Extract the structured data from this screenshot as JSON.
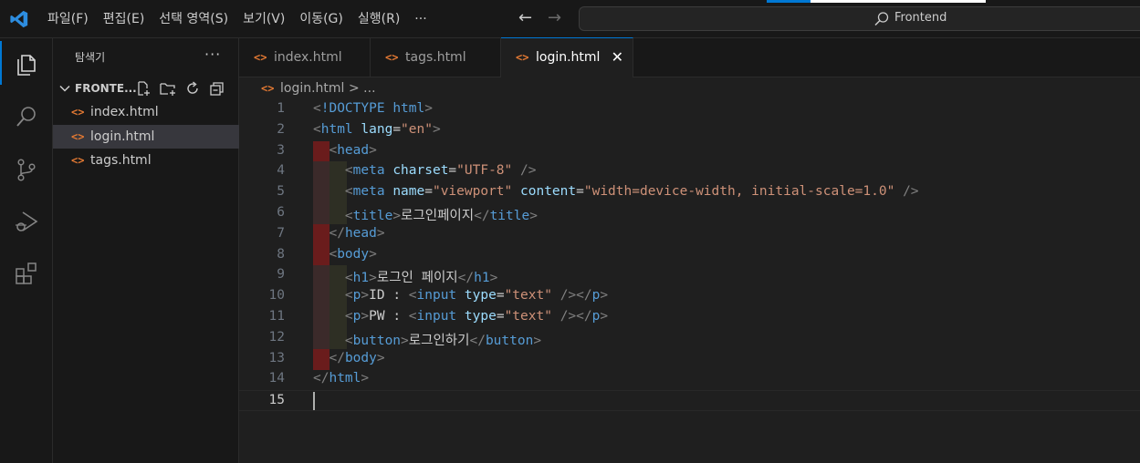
{
  "menu": [
    "파일(F)",
    "편집(E)",
    "선택 영역(S)",
    "보기(V)",
    "이동(G)",
    "실행(R)",
    "···"
  ],
  "nav": {
    "back": "←",
    "forward": "→"
  },
  "command_center": {
    "label": "Frontend"
  },
  "sidebar": {
    "title": "탐색기",
    "more": "···",
    "folder": "FRONTE...",
    "files": [
      {
        "name": "index.html",
        "selected": false
      },
      {
        "name": "login.html",
        "selected": true
      },
      {
        "name": "tags.html",
        "selected": false
      }
    ]
  },
  "tabs": [
    {
      "label": "index.html",
      "active": false
    },
    {
      "label": "tags.html",
      "active": false
    },
    {
      "label": "login.html",
      "active": true
    }
  ],
  "tab_close": "✕",
  "file_icon": "<>",
  "breadcrumb": {
    "file": "login.html",
    "rest": "> ..."
  },
  "editor": {
    "current_line": 15,
    "lines": [
      [
        [
          "br",
          "<"
        ],
        [
          "tag",
          "!DOCTYPE "
        ],
        [
          "tag",
          "html"
        ],
        [
          "br",
          ">"
        ]
      ],
      [
        [
          "br",
          "<"
        ],
        [
          "tag",
          "html"
        ],
        [
          "txt",
          " "
        ],
        [
          "attr",
          "lang"
        ],
        [
          "txt",
          "="
        ],
        [
          "str",
          "\"en\""
        ],
        [
          "br",
          ">"
        ]
      ],
      [
        [
          "txt",
          "  "
        ],
        [
          "br",
          "<"
        ],
        [
          "tag",
          "head"
        ],
        [
          "br",
          ">"
        ]
      ],
      [
        [
          "txt",
          "    "
        ],
        [
          "br",
          "<"
        ],
        [
          "tag",
          "meta"
        ],
        [
          "txt",
          " "
        ],
        [
          "attr",
          "charset"
        ],
        [
          "txt",
          "="
        ],
        [
          "str",
          "\"UTF-8\""
        ],
        [
          "txt",
          " "
        ],
        [
          "br",
          "/>"
        ]
      ],
      [
        [
          "txt",
          "    "
        ],
        [
          "br",
          "<"
        ],
        [
          "tag",
          "meta"
        ],
        [
          "txt",
          " "
        ],
        [
          "attr",
          "name"
        ],
        [
          "txt",
          "="
        ],
        [
          "str",
          "\"viewport\""
        ],
        [
          "txt",
          " "
        ],
        [
          "attr",
          "content"
        ],
        [
          "txt",
          "="
        ],
        [
          "str",
          "\"width=device-width, initial-scale=1.0\""
        ],
        [
          "txt",
          " "
        ],
        [
          "br",
          "/>"
        ]
      ],
      [
        [
          "txt",
          "    "
        ],
        [
          "br",
          "<"
        ],
        [
          "tag",
          "title"
        ],
        [
          "br",
          ">"
        ],
        [
          "txt",
          "로그인페이지"
        ],
        [
          "br",
          "</"
        ],
        [
          "tag",
          "title"
        ],
        [
          "br",
          ">"
        ]
      ],
      [
        [
          "txt",
          "  "
        ],
        [
          "br",
          "</"
        ],
        [
          "tag",
          "head"
        ],
        [
          "br",
          ">"
        ]
      ],
      [
        [
          "txt",
          "  "
        ],
        [
          "br",
          "<"
        ],
        [
          "tag",
          "body"
        ],
        [
          "br",
          ">"
        ]
      ],
      [
        [
          "txt",
          "    "
        ],
        [
          "br",
          "<"
        ],
        [
          "tag",
          "h1"
        ],
        [
          "br",
          ">"
        ],
        [
          "txt",
          "로그인 페이지"
        ],
        [
          "br",
          "</"
        ],
        [
          "tag",
          "h1"
        ],
        [
          "br",
          ">"
        ]
      ],
      [
        [
          "txt",
          "    "
        ],
        [
          "br",
          "<"
        ],
        [
          "tag",
          "p"
        ],
        [
          "br",
          ">"
        ],
        [
          "txt",
          "ID : "
        ],
        [
          "br",
          "<"
        ],
        [
          "tag",
          "input"
        ],
        [
          "txt",
          " "
        ],
        [
          "attr",
          "type"
        ],
        [
          "txt",
          "="
        ],
        [
          "str",
          "\"text\""
        ],
        [
          "txt",
          " "
        ],
        [
          "br",
          "/></"
        ],
        [
          "tag",
          "p"
        ],
        [
          "br",
          ">"
        ]
      ],
      [
        [
          "txt",
          "    "
        ],
        [
          "br",
          "<"
        ],
        [
          "tag",
          "p"
        ],
        [
          "br",
          ">"
        ],
        [
          "txt",
          "PW : "
        ],
        [
          "br",
          "<"
        ],
        [
          "tag",
          "input"
        ],
        [
          "txt",
          " "
        ],
        [
          "attr",
          "type"
        ],
        [
          "txt",
          "="
        ],
        [
          "str",
          "\"text\""
        ],
        [
          "txt",
          " "
        ],
        [
          "br",
          "/></"
        ],
        [
          "tag",
          "p"
        ],
        [
          "br",
          ">"
        ]
      ],
      [
        [
          "txt",
          "    "
        ],
        [
          "br",
          "<"
        ],
        [
          "tag",
          "button"
        ],
        [
          "br",
          ">"
        ],
        [
          "txt",
          "로그인하기"
        ],
        [
          "br",
          "</"
        ],
        [
          "tag",
          "button"
        ],
        [
          "br",
          ">"
        ]
      ],
      [
        [
          "txt",
          "  "
        ],
        [
          "br",
          "</"
        ],
        [
          "tag",
          "body"
        ],
        [
          "br",
          ">"
        ]
      ],
      [
        [
          "br",
          "</"
        ],
        [
          "tag",
          "html"
        ],
        [
          "br",
          ">"
        ]
      ],
      []
    ]
  },
  "colors": {
    "accent": "#0078d4",
    "file_icon": "#e37933"
  }
}
